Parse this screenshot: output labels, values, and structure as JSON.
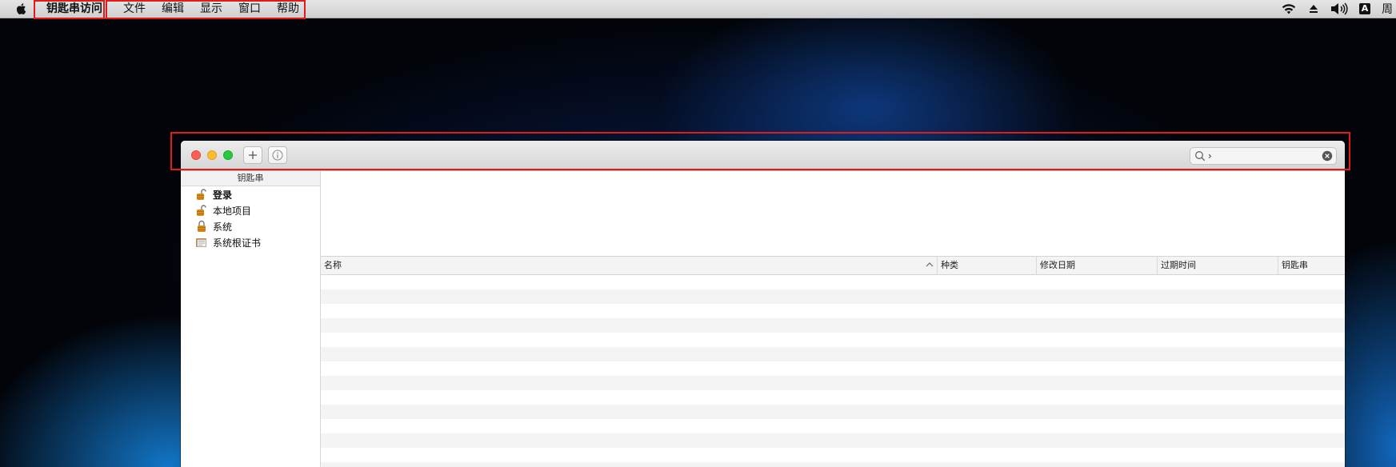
{
  "menubar": {
    "app_name": "钥匙串访问",
    "items": [
      "文件",
      "编辑",
      "显示",
      "窗口",
      "帮助"
    ],
    "ime_label": "A",
    "clock_fragment": "周"
  },
  "window": {
    "search": {
      "value": "›",
      "placeholder": ""
    },
    "sidebar": {
      "header": "钥匙串",
      "items": [
        {
          "label": "登录",
          "icon": "padlock-open-icon",
          "bold": true
        },
        {
          "label": "本地项目",
          "icon": "padlock-open-icon",
          "bold": false
        },
        {
          "label": "系统",
          "icon": "padlock-closed-icon",
          "bold": false
        },
        {
          "label": "系统根证书",
          "icon": "certificate-folder-icon",
          "bold": false
        }
      ]
    },
    "table": {
      "columns": [
        "名称",
        "种类",
        "修改日期",
        "过期时间",
        "钥匙串"
      ],
      "sorted_column": "名称",
      "rows": []
    }
  },
  "colors": {
    "highlight_box": "#e01b1b",
    "close": "#fd5f57",
    "minimize": "#febc2e",
    "zoom": "#28c840"
  }
}
